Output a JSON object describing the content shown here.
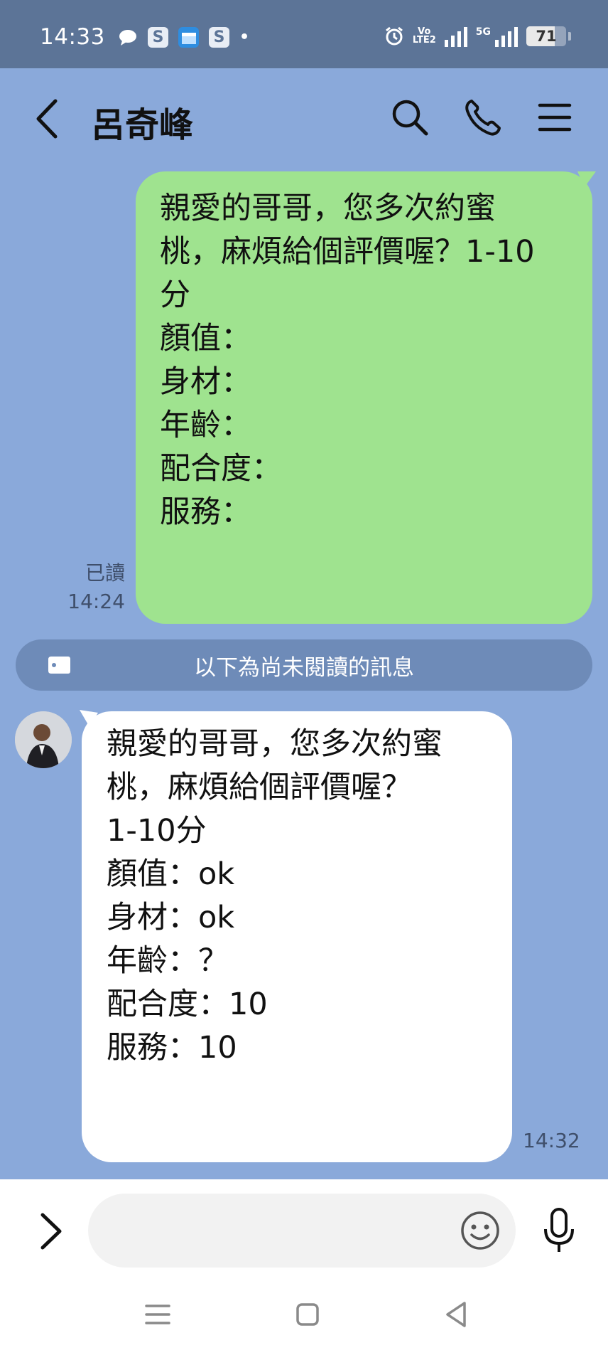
{
  "status_bar": {
    "time": "14:33",
    "notification_icons": [
      "chat-bubble-icon",
      "s-app-icon",
      "calendar-icon",
      "s-app-icon",
      "more-dot-icon"
    ],
    "s_icon_letter": "S",
    "alarm_icon": "alarm-icon",
    "volte_label": "Vo\nLTE2",
    "network_label": "5G",
    "battery_percent": 71,
    "battery_label": "71"
  },
  "header": {
    "contact_name": "呂奇峰",
    "icons": [
      "chevron-left-icon",
      "search-icon",
      "phone-icon",
      "menu-icon"
    ]
  },
  "messages": {
    "outgoing": {
      "text": "親愛的哥哥，您多次約蜜\n桃，麻煩給個評價喔？1-10\n分\n顏值：\n身材：\n年齡：\n配合度：\n服務：",
      "read_label": "已讀",
      "time": "14:24"
    },
    "unread_divider": "以下為尚未閱讀的訊息",
    "incoming": {
      "text": "親愛的哥哥，您多次約蜜\n桃，麻煩給個評價喔？\n1-10分\n顏值：ok\n身材：ok\n年齡：？\n配合度：10\n服務：10",
      "time": "14:32"
    }
  },
  "input_bar": {
    "placeholder": "",
    "value": "",
    "icons": [
      "chevron-right-icon",
      "emoji-icon",
      "microphone-icon"
    ]
  },
  "nav_bar": {
    "icons": [
      "recent-apps-icon",
      "home-icon",
      "back-icon"
    ]
  },
  "colors": {
    "chat_background": "#8aa9da",
    "status_bar": "#5c7497",
    "outgoing_bubble": "#9fe38f",
    "incoming_bubble": "#ffffff",
    "unread_divider": "#6e8bb8"
  }
}
